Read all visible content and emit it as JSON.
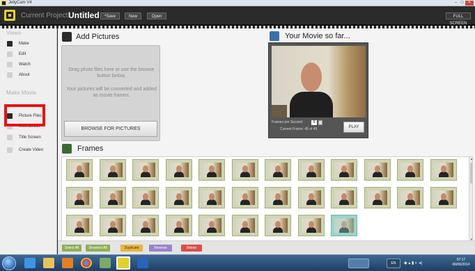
{
  "window": {
    "app_title": "JellyCam V4",
    "min_icon": "minimize-icon",
    "max_icon": "maximize-icon",
    "close_icon": "close-icon",
    "min_label": "–",
    "max_label": "□",
    "close_label": "×"
  },
  "header": {
    "project_label": "Current Project:",
    "project_name": "Untitled",
    "save_label": "*Save",
    "new_label": "New",
    "open_label": "Open",
    "fullscreen_label": "FULL SCREEN"
  },
  "sidebar": {
    "views_heading": "Views",
    "views_items": [
      {
        "label": "Make",
        "icon": "make-icon"
      },
      {
        "label": "Edit",
        "icon": "edit-icon"
      },
      {
        "label": "Watch",
        "icon": "watch-icon"
      },
      {
        "label": "About",
        "icon": "about-icon"
      }
    ],
    "make_heading": "Make Movie",
    "make_items": [
      {
        "label": "Picture Files",
        "icon": "picture-files-icon"
      },
      {
        "label": "Soundtrack",
        "icon": "soundtrack-icon"
      },
      {
        "label": "Title Screen",
        "icon": "title-screen-icon"
      },
      {
        "label": "Create Video",
        "icon": "create-video-icon"
      }
    ]
  },
  "add_pictures": {
    "title": "Add Pictures",
    "drag_text": "Drag photo files here or use the browse button below.",
    "convert_text": "Your pictures will be converted and added as movie frames.",
    "browse_label": "BROWSE FOR PICTURES"
  },
  "movie": {
    "title": "Your Movie so far...",
    "fps_label": "Frames per Second:",
    "fps_value": "5",
    "current_frame_label": "Current Frame: 45 of 45",
    "play_label": "PLAY"
  },
  "frames": {
    "title": "Frames",
    "count": 45,
    "selected_index": 44
  },
  "actions": {
    "select_all": "Select All",
    "deselect_all": "Deselect All",
    "duplicate": "Duplicate",
    "reverse": "Reverse",
    "delete": "Delete"
  },
  "taskbar": {
    "clock_time": "07:17",
    "clock_date": "06/06/2014",
    "tray_label": "EN"
  },
  "colors": {
    "accent": "#e2d12f",
    "highlight": "#e81313",
    "selected_frame": "#9ad5cb"
  }
}
